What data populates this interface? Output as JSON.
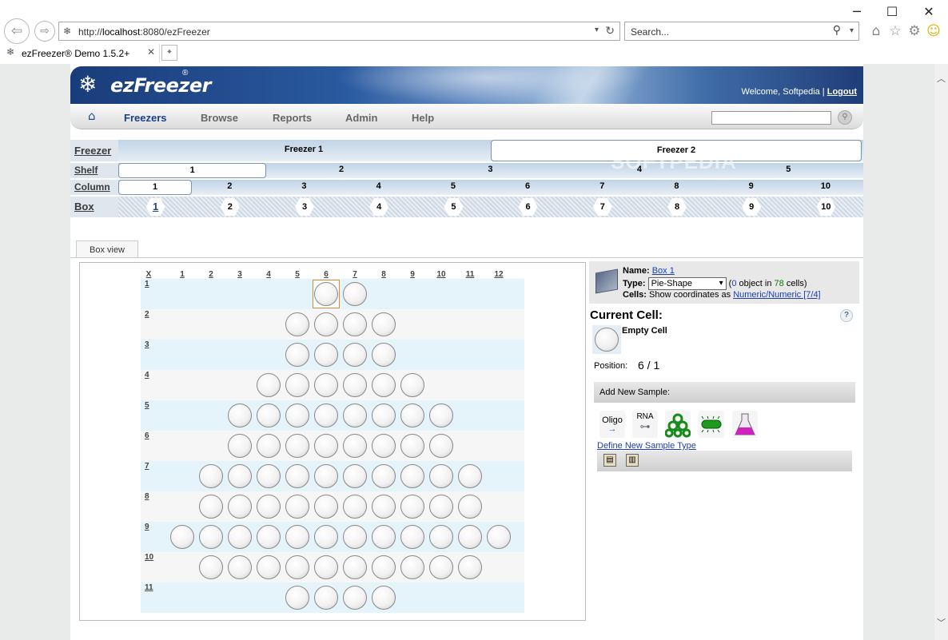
{
  "browser": {
    "url_prefix": "http://",
    "url_host": "localhost",
    "url_rest": ":8080/ezFreezer",
    "search_placeholder": "Search...",
    "tab_title": "ezFreezer® Demo 1.5.2+",
    "window_controls": {
      "minimize": "─",
      "maximize": "☐",
      "close": "✕"
    }
  },
  "app": {
    "logo_text": "ezFreezer",
    "logo_reg": "®",
    "welcome_text": "Welcome, Softpedia | ",
    "logout_label": "Logout",
    "watermark": "SOFTPEDIA"
  },
  "nav": {
    "items": [
      "Freezers",
      "Browse",
      "Reports",
      "Admin",
      "Help"
    ]
  },
  "selectors": {
    "freezer_label": "Freezer",
    "freezers": [
      "Freezer 1",
      "Freezer 2"
    ],
    "active_freezer": "Freezer 2",
    "shelf_label": "Shelf",
    "shelves": [
      "1",
      "2",
      "3",
      "4",
      "5"
    ],
    "active_shelf": "1",
    "column_label": "Column",
    "columns": [
      "1",
      "2",
      "3",
      "4",
      "5",
      "6",
      "7",
      "8",
      "9",
      "10"
    ],
    "active_column": "1",
    "box_label": "Box",
    "boxes": [
      "1",
      "2",
      "3",
      "4",
      "5",
      "6",
      "7",
      "8",
      "9",
      "10"
    ],
    "active_box": "1"
  },
  "box_view": {
    "tab_label": "Box view",
    "corner_label": "X",
    "col_headers": [
      "1",
      "2",
      "3",
      "4",
      "5",
      "6",
      "7",
      "8",
      "9",
      "10",
      "11",
      "12"
    ],
    "row_headers": [
      "1",
      "2",
      "3",
      "4",
      "5",
      "6",
      "7",
      "8",
      "9",
      "10",
      "11"
    ],
    "row_cells": [
      [
        6,
        7
      ],
      [
        5,
        6,
        7,
        8
      ],
      [
        5,
        6,
        7,
        8
      ],
      [
        4,
        5,
        6,
        7,
        8,
        9
      ],
      [
        3,
        4,
        5,
        6,
        7,
        8,
        9,
        10
      ],
      [
        3,
        4,
        5,
        6,
        7,
        8,
        9,
        10
      ],
      [
        2,
        3,
        4,
        5,
        6,
        7,
        8,
        9,
        10,
        11
      ],
      [
        2,
        3,
        4,
        5,
        6,
        7,
        8,
        9,
        10,
        11
      ],
      [
        1,
        2,
        3,
        4,
        5,
        6,
        7,
        8,
        9,
        10,
        11,
        12
      ],
      [
        2,
        3,
        4,
        5,
        6,
        7,
        8,
        9,
        10,
        11
      ],
      [
        5,
        6,
        7,
        8
      ]
    ],
    "selected_cell": {
      "row": 1,
      "col": 6
    }
  },
  "info": {
    "name_label": "Name:",
    "name_value": "Box 1",
    "type_label": "Type:",
    "type_value": "Pie-Shape",
    "object_open": "(",
    "object_count": "0",
    "object_mid": " object in ",
    "cell_count": "78",
    "object_close": " cells)",
    "cells_label": "Cells:",
    "cells_text": "Show coordinates as ",
    "cells_link": "Numeric/Numeric [7/4]",
    "current_cell_title": "Current Cell:",
    "help_symbol": "?",
    "empty_cell_label": "Empty Cell",
    "position_label": "Position:",
    "position_value": "6 / 1",
    "add_sample_label": "Add New Sample:",
    "oligo_label": "Oligo",
    "rna_label": "RNA",
    "define_link": "Define New Sample Type"
  }
}
